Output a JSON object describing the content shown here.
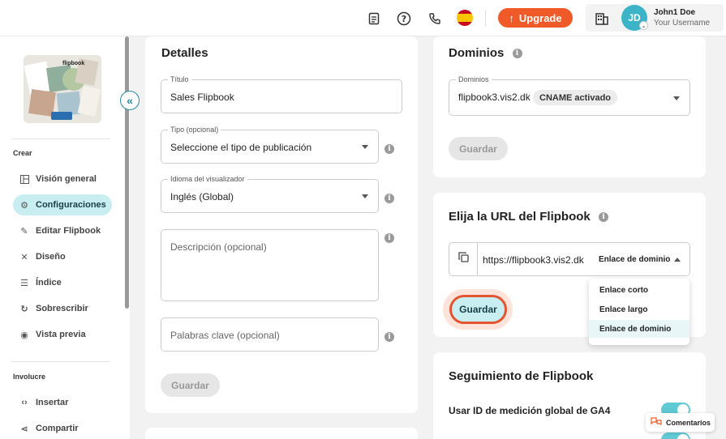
{
  "topbar": {
    "upgrade_label": "Upgrade",
    "user_name": "John1 Doe",
    "user_sub": "Your Username",
    "avatar_initials": "JD",
    "accent_color": "#f05a28"
  },
  "sidebar": {
    "section_create": "Crear",
    "section_involve": "Involucre",
    "items": [
      {
        "label": "Visión general",
        "icon": "layout-icon",
        "active": false
      },
      {
        "label": "Configuraciones",
        "icon": "gear-icon",
        "active": true
      },
      {
        "label": "Editar Flipbook",
        "icon": "pencil-icon",
        "active": false
      },
      {
        "label": "Diseño",
        "icon": "design-tools-icon",
        "active": false
      },
      {
        "label": "Índice",
        "icon": "list-icon",
        "active": false
      },
      {
        "label": "Sobrescribir",
        "icon": "refresh-icon",
        "active": false
      },
      {
        "label": "Vista previa",
        "icon": "eye-icon",
        "active": false
      }
    ],
    "involve_items": [
      {
        "label": "Insertar",
        "icon": "code-icon"
      },
      {
        "label": "Compartir",
        "icon": "share-icon"
      }
    ],
    "thumbnail_text": "flipbook"
  },
  "details": {
    "title": "Detalles",
    "title_field": {
      "label": "Título",
      "value": "Sales Flipbook"
    },
    "type_field": {
      "label": "Tipo (opcional)",
      "value": "Seleccione el tipo de publicación"
    },
    "lang_field": {
      "label": "Idioma del visualizador",
      "value": "Inglés (Global)"
    },
    "description_placeholder": "Descripción (opcional)",
    "keywords_placeholder": "Palabras clave (opcional)",
    "save_label": "Guardar"
  },
  "domains": {
    "title": "Dominios",
    "field_label": "Dominios",
    "value": "flipbook3.vis2.dk",
    "badge": "CNAME activado",
    "save_label": "Guardar"
  },
  "url": {
    "title": "Elija la URL del Flipbook",
    "value": "https://flipbook3.vis2.dk",
    "link_type": "Enlace de dominio",
    "save_label": "Guardar",
    "options": [
      "Enlace corto",
      "Enlace largo",
      "Enlace de dominio"
    ],
    "selected_option": "Enlace de dominio"
  },
  "tracking": {
    "title": "Seguimiento de Flipbook",
    "row1_label": "Usar ID de medición global de GA4",
    "row1_on": true,
    "row2_on": true
  },
  "comments_label": "Comentarios"
}
